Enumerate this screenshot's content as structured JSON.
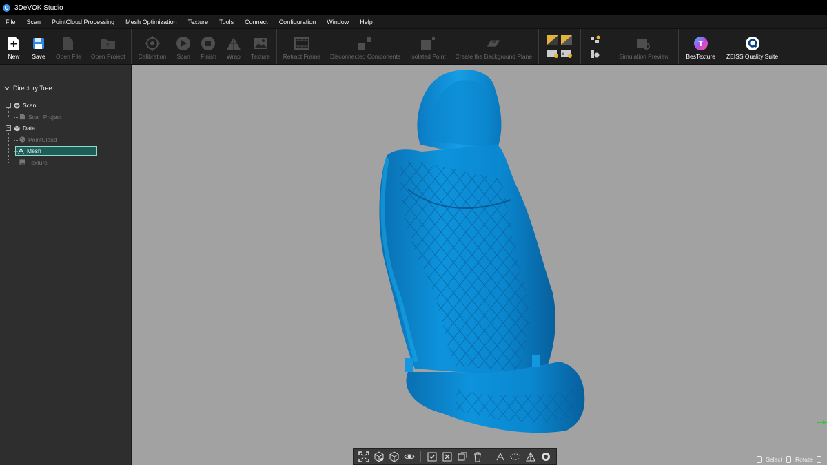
{
  "window": {
    "title": "3DeVOK Studio"
  },
  "menu": [
    "File",
    "Scan",
    "PointCloud Processing",
    "Mesh Optimization",
    "Texture",
    "Tools",
    "Connect",
    "Configuration",
    "Window",
    "Help"
  ],
  "toolbar": {
    "new": "New",
    "save": "Save",
    "open_file": "Open File",
    "open_project": "Open Project",
    "calibration": "Calibration",
    "scan": "Scan",
    "finish": "Finish",
    "wrap": "Wrap",
    "texture": "Texture",
    "retract_frame": "Retract Frame",
    "disconnected_components": "Disconnected Components",
    "isolated_point": "Isolated Point",
    "create_background_plane": "Create the Background Plane",
    "simulation_preview": "Simulation Preview",
    "bestexture": "BesTexture",
    "zeiss": "ZEISS Quality Suite"
  },
  "sidebar": {
    "header": "Directory Tree",
    "scan": "Scan",
    "scan_project": "Scan Project",
    "data": "Data",
    "pointcloud": "PointCloud",
    "mesh": "Mesh",
    "texture": "Texture"
  },
  "hints": {
    "select": "Select",
    "rotate": "Rotate"
  },
  "colors": {
    "mesh": "#0a8fd6",
    "accent": "#8ed9d0",
    "viewport": "#a2a2a2"
  }
}
